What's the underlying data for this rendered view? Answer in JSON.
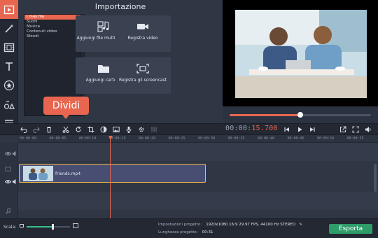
{
  "import_panel": {
    "title": "Importazione",
    "categories": [
      "I miei file",
      "Suoni",
      "Musica",
      "Contenuti video",
      "Sfondi"
    ],
    "tiles": [
      {
        "label": "Aggiungi file multimediali",
        "icon": "media-files-icon"
      },
      {
        "label": "Registra video",
        "icon": "camera-icon"
      },
      {
        "label": "Aggiungi cartella",
        "icon": "folder-icon"
      },
      {
        "label": "Registra gli screencast",
        "icon": "screencast-icon"
      }
    ]
  },
  "tools": [
    "import-icon",
    "magic-wand-icon",
    "filmstrip-icon",
    "text-icon",
    "star-icon",
    "shapes-icon",
    "menu-icon"
  ],
  "player": {
    "progress": 0.5
  },
  "timecode": {
    "prefix": "00:00:",
    "highlight": "15.700"
  },
  "tooltip": {
    "label": "Dividi"
  },
  "timeline": {
    "ticks": [
      "00:00:00",
      "00:00:05",
      "00:00:10",
      "00:00:15",
      "00:00:20",
      "00:00:25",
      "00:00:30",
      "00:00:35",
      "00:00:40",
      "00:00:45",
      "00:00:50",
      "00:00:55"
    ],
    "clip_name": "friends.mp4"
  },
  "footer": {
    "scale_label": "Scala:",
    "scale_level": 0.6,
    "settings_label": "Impostazioni progetto:",
    "settings_value": "1920x1080 16:9 29.97 FPS, 44100 Hz STEREO",
    "length_label": "Lunghezza progetto:",
    "length_value": "00:31",
    "export_label": "Esporta"
  },
  "colors": {
    "accent": "#e8664f",
    "export": "#2e9d6a",
    "clip_border": "#f5b94a"
  }
}
